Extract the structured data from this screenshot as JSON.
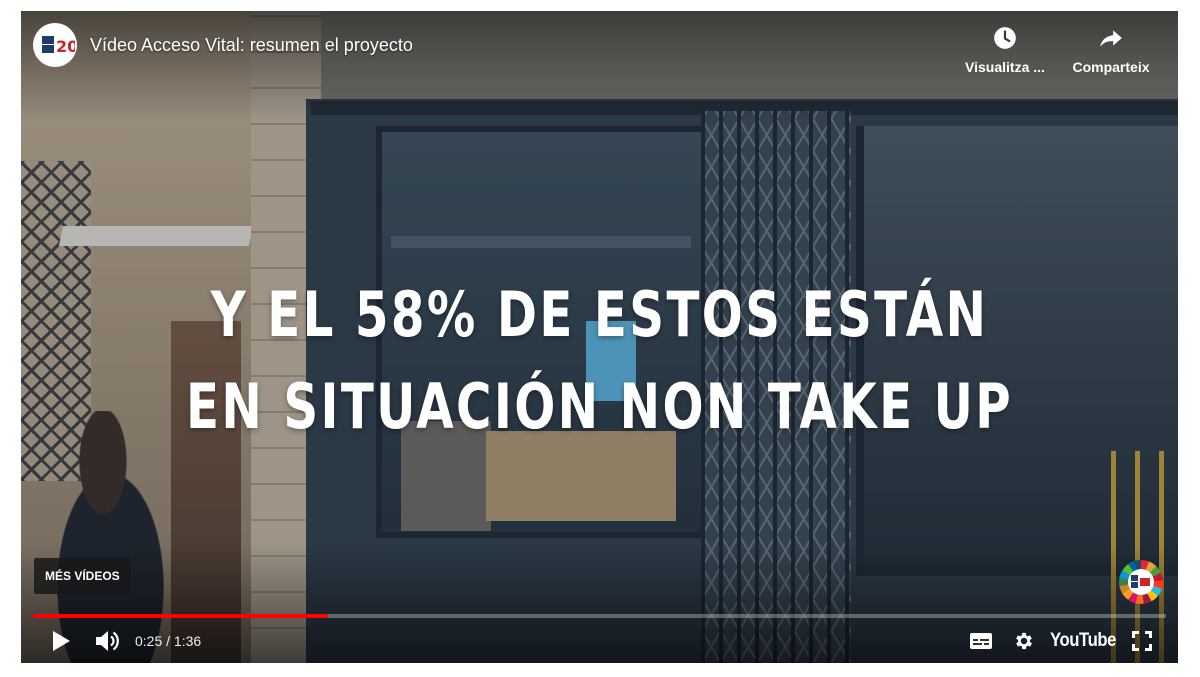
{
  "header": {
    "title": "Vídeo Acceso Vital: resumen el proyecto",
    "channel_logo_text": "EAPN20",
    "watch_later_label": "Visualitza ...",
    "share_label": "Comparteix"
  },
  "caption": {
    "line1": "Y EL 58% DE ESTOS ESTÁN",
    "line2": "EN SITUACIÓN NON TAKE UP"
  },
  "more_videos_label": "MÉS VÍDEOS",
  "controls": {
    "current_time": "0:25",
    "duration": "1:36",
    "time_display": "0:25 / 1:36",
    "youtube_label": "YouTube"
  },
  "progress": {
    "played_fraction": 0.26,
    "loaded_fraction": 0.26
  },
  "icons": {
    "watch_later": "clock-icon",
    "share": "share-icon",
    "play": "play-icon",
    "volume": "volume-icon",
    "captions": "captions-icon",
    "settings": "gear-icon",
    "fullscreen": "fullscreen-icon"
  },
  "colors": {
    "progress_played": "#ff0000",
    "caption_text": "#ffffff"
  }
}
